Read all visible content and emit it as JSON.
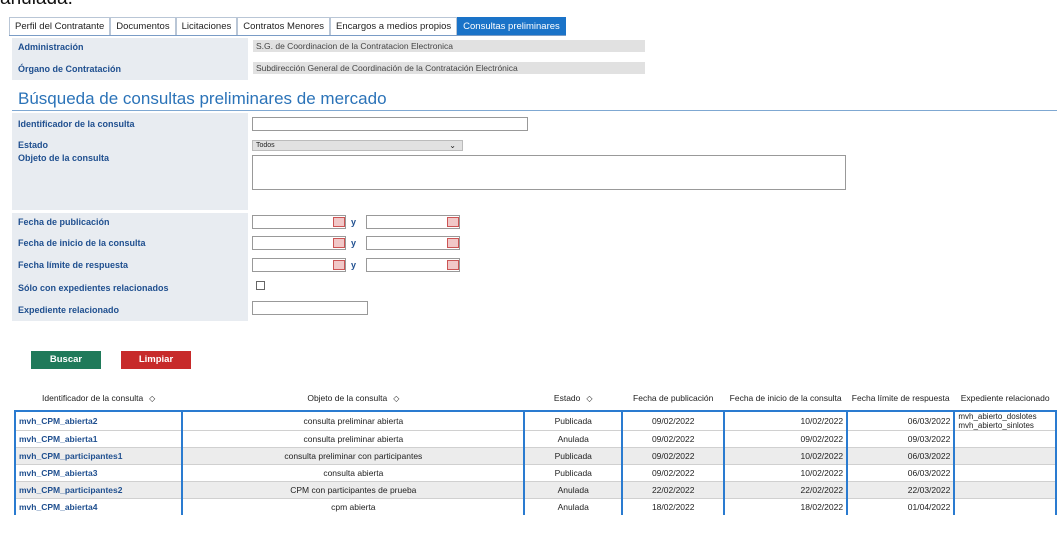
{
  "top_cut_text": "anulada.",
  "tabs": [
    {
      "label": "Perfil del Contratante"
    },
    {
      "label": "Documentos"
    },
    {
      "label": "Licitaciones"
    },
    {
      "label": "Contratos Menores"
    },
    {
      "label": "Encargos a medios propios"
    },
    {
      "label": "Consultas preliminares"
    }
  ],
  "info": {
    "admin_label": "Administración",
    "admin_value": "S.G. de Coordinacion de la Contratacion Electronica",
    "organo_label": "Órgano de Contratación",
    "organo_value": "Subdirección General de Coordinación de la Contratación Electrónica"
  },
  "search": {
    "title": "Búsqueda de consultas preliminares de mercado",
    "id_label": "Identificador de la consulta",
    "estado_label": "Estado",
    "estado_value": "Todos",
    "objeto_label": "Objeto de la consulta",
    "fecha_pub_label": "Fecha de publicación",
    "fecha_ini_label": "Fecha de inicio de la consulta",
    "fecha_lim_label": "Fecha límite de respuesta",
    "y": "y",
    "solo_label": "Sólo con expedientes relacionados",
    "exp_label": "Expediente relacionado"
  },
  "buttons": {
    "buscar": "Buscar",
    "limpiar": "Limpiar"
  },
  "table": {
    "headers": [
      "Identificador de la consulta",
      "Objeto de la consulta",
      "Estado",
      "Fecha de publicación",
      "Fecha de inicio de la consulta",
      "Fecha límite de respuesta",
      "Expediente relacionado"
    ],
    "rows": [
      {
        "id": "mvh_CPM_abierta2",
        "objeto": "consulta preliminar abierta",
        "estado": "Publicada",
        "pub": "09/02/2022",
        "ini": "10/02/2022",
        "lim": "06/03/2022",
        "exp": "mvh_abierto_doslotes",
        "exp2": "mvh_abierto_sinlotes"
      },
      {
        "id": "mvh_CPM_abierta1",
        "objeto": "consulta preliminar abierta",
        "estado": "Anulada",
        "pub": "09/02/2022",
        "ini": "09/02/2022",
        "lim": "09/03/2022",
        "exp": "",
        "exp2": ""
      },
      {
        "id": "mvh_CPM_participantes1",
        "objeto": "consulta preliminar con participantes",
        "estado": "Publicada",
        "pub": "09/02/2022",
        "ini": "10/02/2022",
        "lim": "06/03/2022",
        "exp": "",
        "exp2": ""
      },
      {
        "id": "mvh_CPM_abierta3",
        "objeto": "consulta abierta",
        "estado": "Publicada",
        "pub": "09/02/2022",
        "ini": "10/02/2022",
        "lim": "06/03/2022",
        "exp": "",
        "exp2": ""
      },
      {
        "id": "mvh_CPM_participantes2",
        "objeto": "CPM con participantes de prueba",
        "estado": "Anulada",
        "pub": "22/02/2022",
        "ini": "22/02/2022",
        "lim": "22/03/2022",
        "exp": "",
        "exp2": ""
      },
      {
        "id": "mvh_CPM_abierta4",
        "objeto": "cpm abierta",
        "estado": "Anulada",
        "pub": "18/02/2022",
        "ini": "18/02/2022",
        "lim": "01/04/2022",
        "exp": "",
        "exp2": ""
      }
    ]
  }
}
